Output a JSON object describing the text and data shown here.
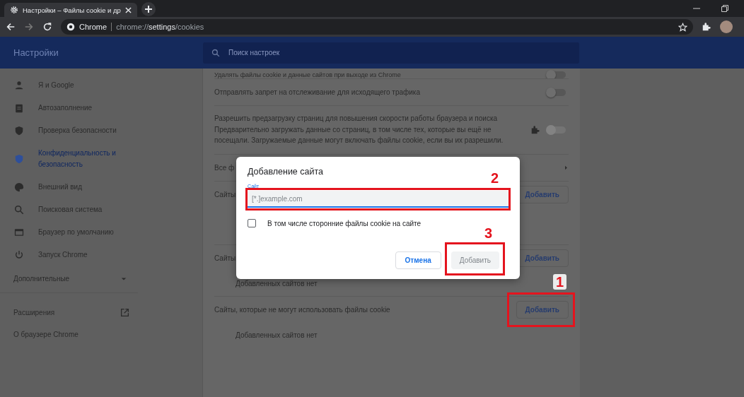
{
  "browser": {
    "tab_title": "Настройки – Файлы cookie и др",
    "site_chip": "Chrome",
    "url": "chrome://**settings**/cookies"
  },
  "header": {
    "title": "Настройки",
    "search": {
      "placeholder": "Поиск настроек"
    }
  },
  "sidebar": {
    "items": [
      {
        "label": "Я и Google",
        "selected": false
      },
      {
        "label": "Автозаполнение",
        "selected": false
      },
      {
        "label": "Проверка безопасности",
        "selected": false
      },
      {
        "label": "Конфиденциальность и безопасность",
        "selected": true
      },
      {
        "label": "Внешний вид",
        "selected": false
      },
      {
        "label": "Поисковая система",
        "selected": false
      },
      {
        "label": "Браузер по умолчанию",
        "selected": false
      },
      {
        "label": "Запуск Chrome",
        "selected": false
      }
    ],
    "advanced": {
      "label": "Дополнительные",
      "expanded": false
    },
    "links": [
      "Расширения",
      "О браузере Chrome"
    ]
  },
  "content": {
    "rows": [
      {
        "kind": "toggle",
        "label": "Удалять файлы cookie и данные сайтов при выходе из Chrome",
        "on": false,
        "disabled": false
      },
      {
        "kind": "toggle",
        "label": "Отправлять запрет на отслеживание для исходящего трафика",
        "on": false,
        "disabled": false
      },
      {
        "kind": "toggle",
        "label": "Разрешить предзагрузку страниц для повышения скорости работы браузера и поиска",
        "description": "Предварительно загружать данные со страниц, в том числе тех, которые вы ещё не посещали. Загружаемые данные могут включать файлы cookie, если вы их разрешили.",
        "on": false,
        "disabled": true
      },
      {
        "kind": "link",
        "label": "Все ф"
      },
      {
        "kind": "add",
        "label": "Сайты",
        "button": "Добавить"
      },
      {
        "kind": "empty"
      },
      {
        "kind": "add",
        "label": "Сайты",
        "button": "Добавить"
      },
      {
        "kind": "note",
        "label": "Добавленных сайтов нет"
      },
      {
        "kind": "add",
        "label": "Сайты, которые не могут использовать файлы cookie",
        "button": "Добавить",
        "mark": "1"
      },
      {
        "kind": "note",
        "label": "Добавленных сайтов нет"
      }
    ]
  },
  "dialog": {
    "title": "Добавление сайта",
    "field_label": "Сайт",
    "field_placeholder": "[*.]example.com",
    "field_mark": "2",
    "checkbox": {
      "label": "В том числе сторонние файлы cookie на сайте",
      "checked": false
    },
    "cancel": "Отмена",
    "confirm": {
      "label": "Добавить",
      "disabled": true,
      "mark": "3"
    }
  }
}
